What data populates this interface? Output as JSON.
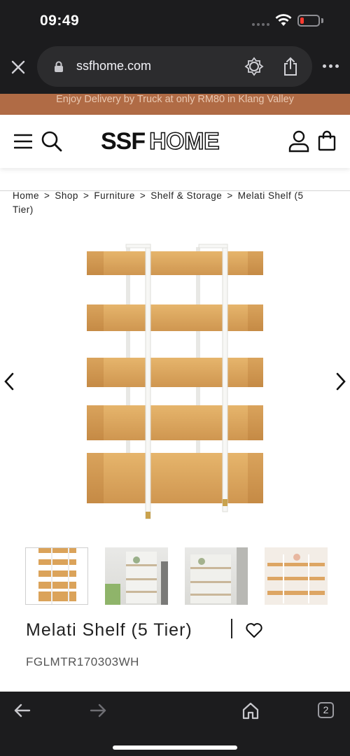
{
  "status_bar": {
    "time": "09:49",
    "battery_level": 0.2
  },
  "browser": {
    "url": "ssfhome.com",
    "tab_count": "2"
  },
  "promo": {
    "text": "Enjoy Delivery by Truck at only RM80 in Klang Valley"
  },
  "site": {
    "logo_bold": "SSF",
    "logo_outline": "HOME"
  },
  "breadcrumb": {
    "items": [
      "Home",
      "Shop",
      "Furniture",
      "Shelf & Storage",
      "Melati Shelf (5 Tier)"
    ],
    "separator": ">"
  },
  "product": {
    "title": "Melati Shelf (5 Tier)",
    "sku": "FGLMTR170303WH",
    "thumbnail_count": 4
  },
  "colors": {
    "promo_bg": "#b06b45",
    "wood": "#d9a45a",
    "frame": "#f4f4f2",
    "dark_chrome": "#1c1c1e"
  },
  "icons": {
    "close": "close-icon",
    "lock": "lock-icon",
    "reader": "reader-mode-icon",
    "share": "share-icon",
    "more": "more-icon",
    "menu": "menu-icon",
    "search": "search-icon",
    "account": "account-icon",
    "bag": "shopping-bag-icon",
    "heart": "heart-icon",
    "back": "back-arrow-icon",
    "forward": "forward-arrow-icon",
    "home": "home-icon"
  }
}
